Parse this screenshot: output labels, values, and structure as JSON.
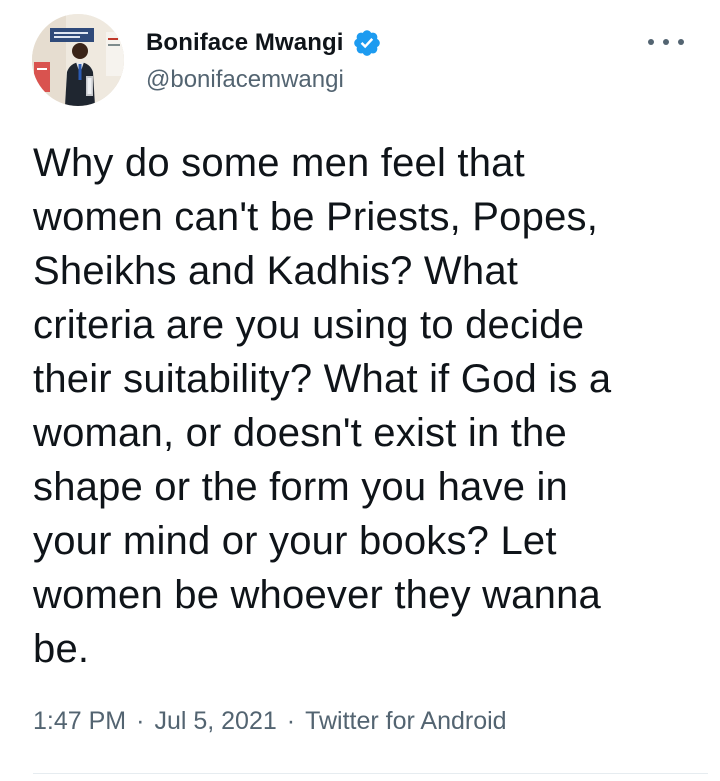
{
  "author": {
    "display_name": "Boniface Mwangi",
    "handle": "@bonifacemwangi",
    "verified": true,
    "verified_icon": "verified-badge-icon",
    "avatar_icon": "profile-photo"
  },
  "tweet": {
    "text": "Why do some men feel that\nwomen can't be Priests, Popes,\nSheikhs and Kadhis? What\ncriteria are you using to decide\ntheir suitability? What if God is a\nwoman, or doesn't exist in the\nshape or the form you have in\nyour mind or your books? Let\nwomen be whoever they wanna\nbe."
  },
  "meta": {
    "time": "1:47 PM",
    "separator": "·",
    "date": "Jul 5, 2021",
    "source": "Twitter for Android"
  },
  "menu": {
    "icon": "more-options-icon"
  },
  "colors": {
    "text_primary": "#0f1419",
    "text_secondary": "#536471",
    "verified_blue": "#1d9bf0",
    "divider": "#e6ecf0"
  }
}
